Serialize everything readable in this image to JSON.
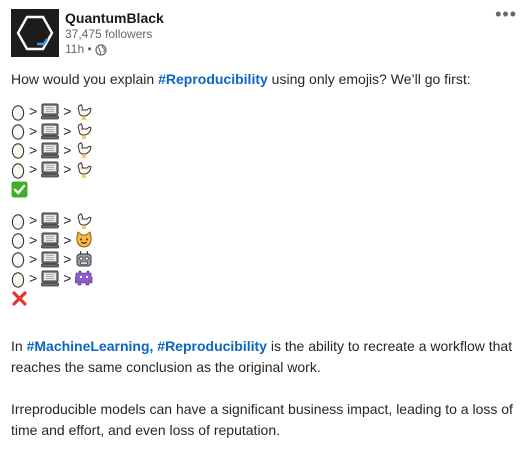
{
  "author": {
    "name": "QuantumBlack",
    "followers": "37,475 followers",
    "time": "11h •"
  },
  "post": {
    "intro_pre": "How would you explain ",
    "intro_tag": "#Reproducibility",
    "intro_post": " using only emojis? We’ll go first:",
    "emoji_rows_1": [
      [
        "egg",
        "computer",
        "chicken"
      ],
      [
        "egg",
        "computer",
        "chicken"
      ],
      [
        "egg",
        "computer",
        "chicken"
      ],
      [
        "egg",
        "computer",
        "chicken"
      ]
    ],
    "result_1": "check-mark-icon",
    "emoji_rows_2": [
      [
        "egg",
        "computer",
        "chicken"
      ],
      [
        "egg",
        "computer",
        "cat-face"
      ],
      [
        "egg",
        "computer",
        "robot-face"
      ],
      [
        "egg",
        "computer",
        "alien-monster"
      ]
    ],
    "result_2": "cross-mark-icon",
    "separator": ">",
    "p1_pre": "In ",
    "p1_tag1": "#MachineLearning",
    "p1_comma": ", ",
    "p1_tag2": "#Reproducibility",
    "p1_post": " is the ability to recreate a workflow that reaches the same conclusion as the original work.",
    "p2": "Irreproducible models can have a significant business impact, leading to a loss of time and effort, and even loss of reputation."
  },
  "colors": {
    "hashtag": "#0a66c2",
    "check_bg": "#3fae29",
    "cross": "#e0362b"
  }
}
